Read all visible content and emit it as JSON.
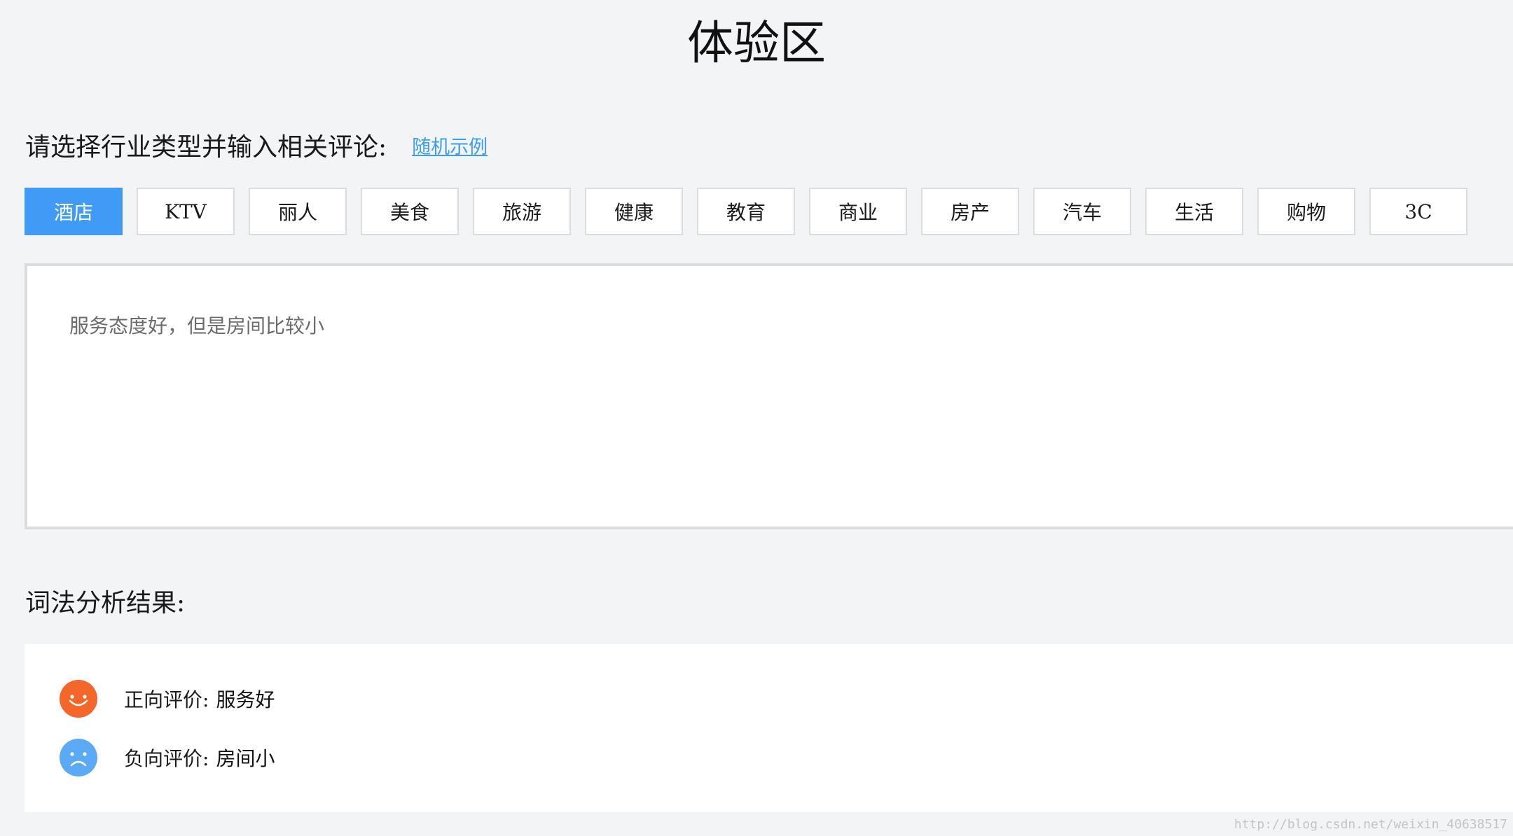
{
  "header": {
    "title": "体验区"
  },
  "prompt": {
    "label": "请选择行业类型并输入相关评论:",
    "random_link": "随机示例"
  },
  "industry_tabs": [
    {
      "label": "酒店",
      "active": true
    },
    {
      "label": "KTV",
      "active": false
    },
    {
      "label": "丽人",
      "active": false
    },
    {
      "label": "美食",
      "active": false
    },
    {
      "label": "旅游",
      "active": false
    },
    {
      "label": "健康",
      "active": false
    },
    {
      "label": "教育",
      "active": false
    },
    {
      "label": "商业",
      "active": false
    },
    {
      "label": "房产",
      "active": false
    },
    {
      "label": "汽车",
      "active": false
    },
    {
      "label": "生活",
      "active": false
    },
    {
      "label": "购物",
      "active": false
    },
    {
      "label": "3C",
      "active": false
    }
  ],
  "comment": {
    "value": "服务态度好，但是房间比较小"
  },
  "results": {
    "heading": "词法分析结果:",
    "positive": {
      "label": "正向评价:",
      "value": "服务好",
      "icon": "smiley-face-icon",
      "color": "#f4662a"
    },
    "negative": {
      "label": "负向评价:",
      "value": "房间小",
      "icon": "sad-face-icon",
      "color": "#5aaaf5"
    }
  },
  "colors": {
    "accent": "#3f9bf5",
    "link": "#3d9df1",
    "background": "#f3f4f6"
  },
  "watermark": "http://blog.csdn.net/weixin_40638517"
}
